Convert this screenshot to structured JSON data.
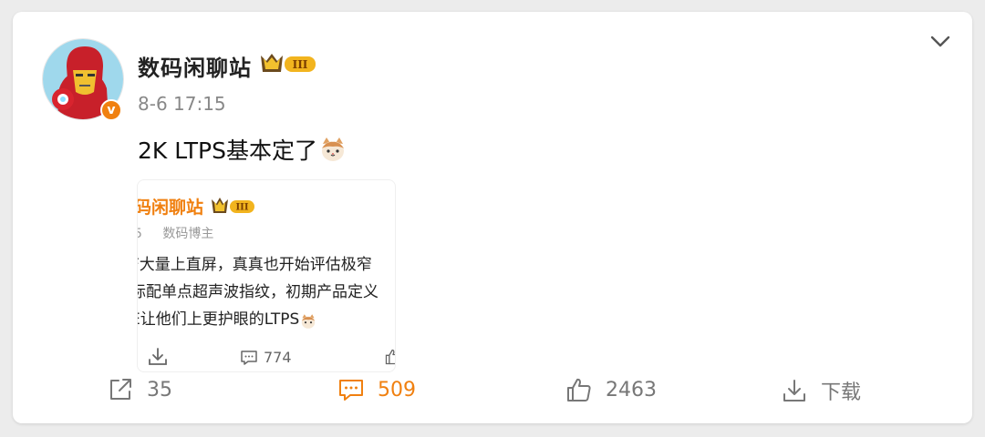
{
  "post": {
    "author": "数码闲聊站",
    "level_badge": "III",
    "timestamp": "8-6 17:15",
    "text": "2K LTPS基本定了",
    "emoji": "cat-face-emoji"
  },
  "repost": {
    "author": "码闲聊站",
    "level_badge": "III",
    "meta_left": "5",
    "meta_role": "数码博主",
    "lines": [
      "F大量上直屏，真真也开始评估极窄",
      "际配单点超声波指纹，初期产品定义",
      "E让他们上更护眼的LTPS"
    ],
    "comment_count": "774"
  },
  "actions": {
    "share_count": "35",
    "comment_count": "509",
    "like_count": "2463",
    "download_label": "下载"
  },
  "colors": {
    "accent": "#f08010",
    "text": "#222222",
    "muted": "#888888"
  }
}
